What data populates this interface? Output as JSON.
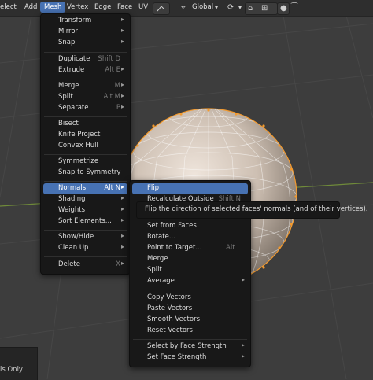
{
  "header": {
    "items": [
      "elect",
      "Add",
      "Mesh",
      "Vertex",
      "Edge",
      "Face",
      "UV"
    ],
    "transform_orientation": "Global"
  },
  "mesh_menu": {
    "items": [
      {
        "label": "Transform",
        "submenu": true
      },
      {
        "label": "Mirror",
        "submenu": true
      },
      {
        "label": "Snap",
        "submenu": true
      },
      {
        "label": "Duplicate",
        "shortcut": "Shift D"
      },
      {
        "label": "Extrude",
        "shortcut": "Alt E"
      },
      {
        "label": "Merge",
        "shortcut": "M"
      },
      {
        "label": "Split",
        "shortcut": "Alt M"
      },
      {
        "label": "Separate",
        "shortcut": "P"
      },
      {
        "label": "Bisect"
      },
      {
        "label": "Knife Project"
      },
      {
        "label": "Convex Hull"
      },
      {
        "label": "Symmetrize"
      },
      {
        "label": "Snap to Symmetry"
      },
      {
        "label": "Normals",
        "shortcut": "Alt N",
        "highlighted": true
      },
      {
        "label": "Shading",
        "submenu": true
      },
      {
        "label": "Weights",
        "submenu": true
      },
      {
        "label": "Sort Elements...",
        "submenu": true
      },
      {
        "label": "Show/Hide",
        "submenu": true
      },
      {
        "label": "Clean Up",
        "submenu": true
      },
      {
        "label": "Delete",
        "shortcut": "X"
      }
    ]
  },
  "normals_menu": {
    "items": [
      {
        "label": "Flip",
        "highlighted": true
      },
      {
        "label": "Recalculate Outside",
        "shortcut": "Shift N"
      },
      {
        "label": "Set from Faces"
      },
      {
        "label": "Rotate..."
      },
      {
        "label": "Point to Target...",
        "shortcut": "Alt L"
      },
      {
        "label": "Merge"
      },
      {
        "label": "Split"
      },
      {
        "label": "Average",
        "submenu": true
      },
      {
        "label": "Copy Vectors"
      },
      {
        "label": "Paste Vectors"
      },
      {
        "label": "Smooth Vectors"
      },
      {
        "label": "Reset Vectors"
      },
      {
        "label": "Select by Face Strength",
        "submenu": true
      },
      {
        "label": "Set Face Strength",
        "submenu": true
      }
    ]
  },
  "tooltip": "Flip the direction of selected faces' normals (and of their vertices).",
  "bottom_panel": {
    "label": "ls Only"
  }
}
